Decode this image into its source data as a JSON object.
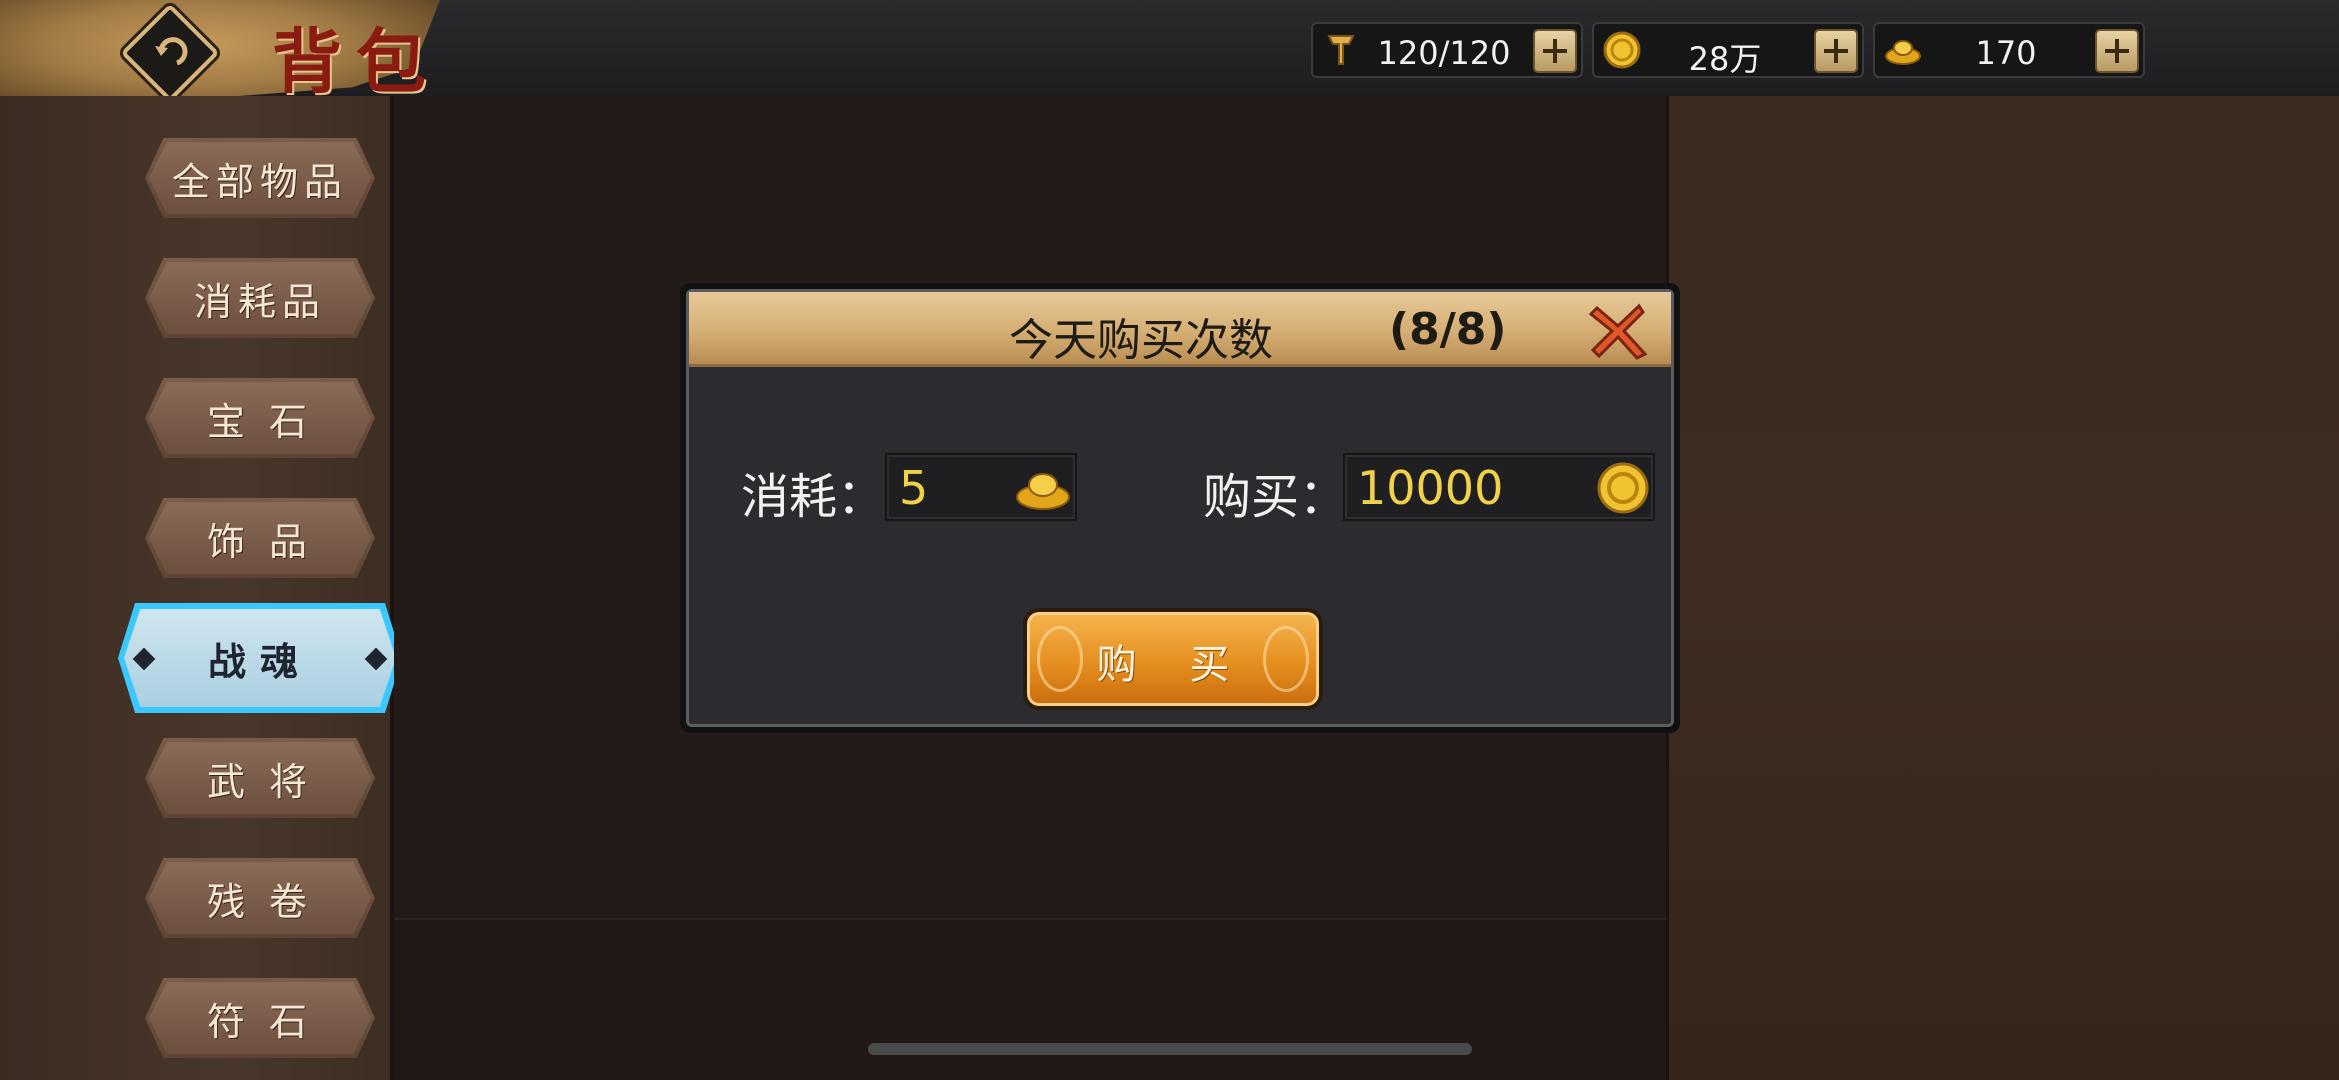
{
  "header": {
    "title": "背包",
    "resources": [
      {
        "name": "stamina",
        "icon": "sword-banner-icon",
        "value": "120/120"
      },
      {
        "name": "coins",
        "icon": "gold-coin-icon",
        "value": "28万"
      },
      {
        "name": "ingots",
        "icon": "gold-ingot-icon",
        "value": "170"
      }
    ]
  },
  "sidebar": {
    "items": [
      {
        "label": "全部物品"
      },
      {
        "label": "消耗品"
      },
      {
        "label": "宝 石"
      },
      {
        "label": "饰 品"
      },
      {
        "label": "战魂",
        "active": true
      },
      {
        "label": "武 将"
      },
      {
        "label": "残 卷"
      },
      {
        "label": "符 石"
      }
    ]
  },
  "dialog": {
    "title": "今天购买次数",
    "count": "(8/8)",
    "cost_label": "消耗：",
    "cost_value": "5",
    "buy_label": "购买：",
    "buy_value": "10000",
    "button": "购 买"
  },
  "colors": {
    "accent_active": "#3ac8ff",
    "dialog_header": "#d5ae73",
    "value_text": "#f0d24a",
    "buy_button": "#e58f1f"
  }
}
